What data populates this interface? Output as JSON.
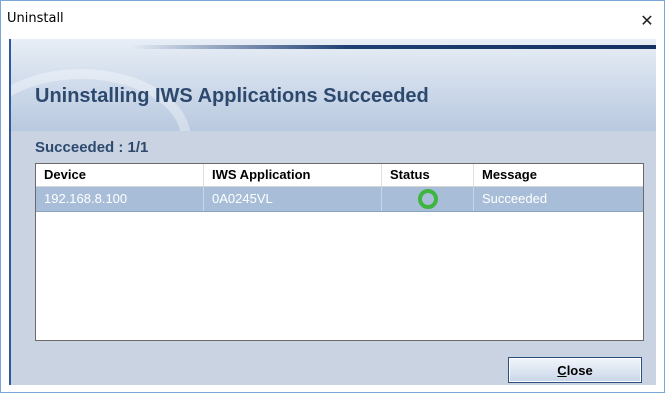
{
  "window": {
    "title": "Uninstall",
    "close_glyph": "✕"
  },
  "banner": {
    "heading": "Uninstalling IWS Applications Succeeded"
  },
  "summary": {
    "label": "Succeeded : 1/1"
  },
  "table": {
    "columns": [
      "Device",
      "IWS Application",
      "Status",
      "Message"
    ],
    "rows": [
      {
        "device": "192.168.8.100",
        "application": "0A0245VL",
        "status": "success-ring-icon",
        "message": "Succeeded"
      }
    ]
  },
  "footer": {
    "close_button_label": "Close",
    "close_button_accel": "C",
    "close_button_rest": "lose"
  },
  "colors": {
    "heading": "#2d4a6e",
    "selected_row": "#a8bed8",
    "status_ok": "#3fb53f",
    "panel": "#c9d3e2"
  }
}
